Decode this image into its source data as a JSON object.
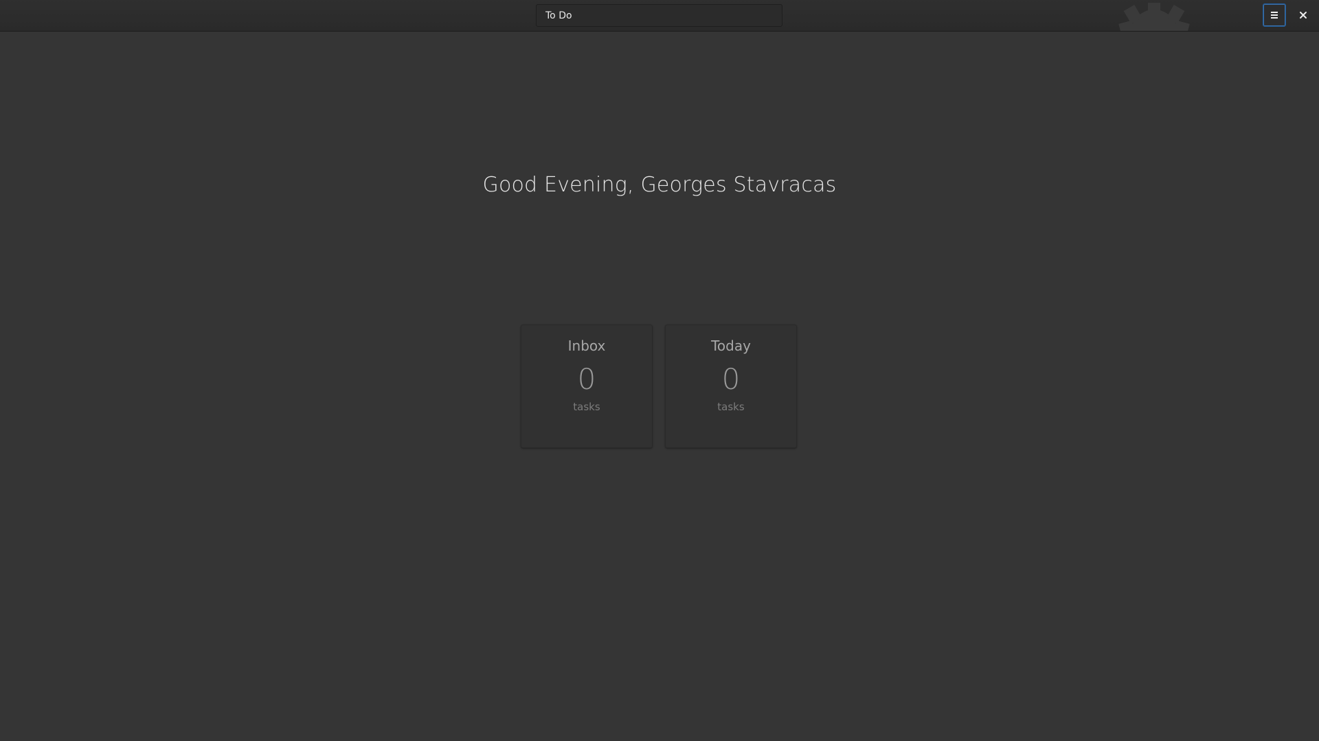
{
  "header": {
    "title_value": "To Do",
    "menu_icon": "hamburger-menu-icon",
    "close_icon": "close-icon",
    "accent_color": "#215d9c"
  },
  "main": {
    "greeting": "Good Evening, Georges Stavracas",
    "cards": [
      {
        "title": "Inbox",
        "count": "0",
        "unit": "tasks"
      },
      {
        "title": "Today",
        "count": "0",
        "unit": "tasks"
      }
    ]
  }
}
